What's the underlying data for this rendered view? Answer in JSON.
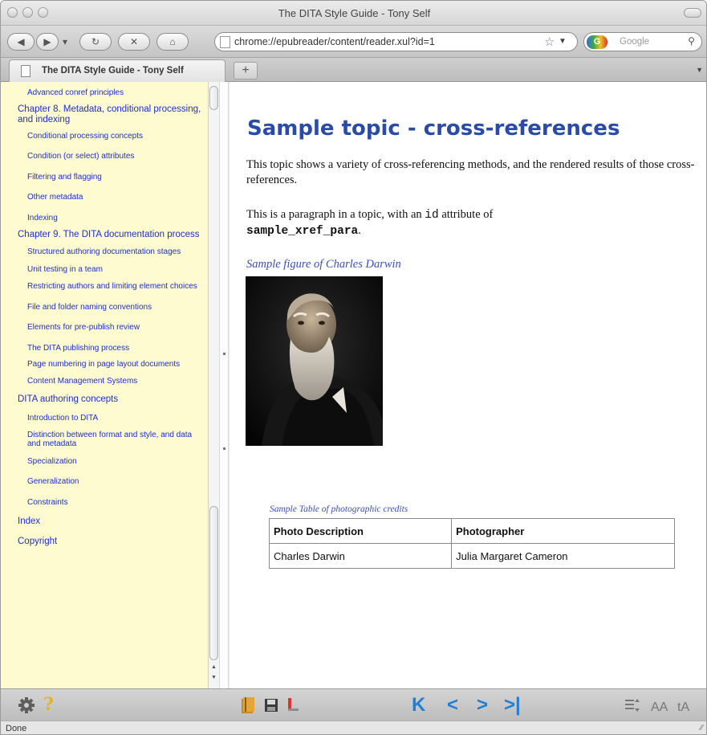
{
  "window": {
    "title": "The DITA Style Guide - Tony Self"
  },
  "navbar": {
    "url": "chrome://epubreader/content/reader.xul?id=1",
    "search_placeholder": "Google",
    "search_engine_badge": "G"
  },
  "tabs": [
    {
      "label": "The DITA Style Guide - Tony Self"
    }
  ],
  "toc": [
    {
      "label": "Advanced conref principles",
      "level": 2
    },
    {
      "label": "Chapter 8. Metadata, conditional processing, and indexing",
      "level": 1
    },
    {
      "label": "Conditional processing concepts",
      "level": 2
    },
    {
      "label": "Condition (or select) attributes",
      "level": 2
    },
    {
      "label": "Filtering and flagging",
      "level": 2
    },
    {
      "label": "Other metadata",
      "level": 2
    },
    {
      "label": "Indexing",
      "level": 2
    },
    {
      "label": "Chapter 9. The DITA documentation process",
      "level": 1
    },
    {
      "label": "Structured authoring documentation stages",
      "level": 2
    },
    {
      "label": "Unit testing in a team",
      "level": 2
    },
    {
      "label": "Restricting authors and limiting element choices",
      "level": 2
    },
    {
      "label": "File and folder naming conventions",
      "level": 2
    },
    {
      "label": "Elements for pre-publish review",
      "level": 2
    },
    {
      "label": "The DITA publishing process",
      "level": 2
    },
    {
      "label": "Page numbering in page layout documents",
      "level": 2
    },
    {
      "label": "Content Management Systems",
      "level": 2
    },
    {
      "label": "DITA authoring concepts",
      "level": 1
    },
    {
      "label": "Introduction to DITA",
      "level": 2
    },
    {
      "label": "Distinction between format and style, and data and metadata",
      "level": 2
    },
    {
      "label": "Specialization",
      "level": 2
    },
    {
      "label": "Generalization",
      "level": 2
    },
    {
      "label": "Constraints",
      "level": 2
    },
    {
      "label": "Index",
      "level": 1
    },
    {
      "label": "Copyright",
      "level": 1
    }
  ],
  "content": {
    "heading": "Sample topic - cross-references",
    "para1": "This topic shows a variety of cross-referencing methods, and the rendered results of those cross-references.",
    "para2_start": "This is a paragraph in a topic, with an ",
    "para2_code": "id",
    "para2_mid": " attribute of",
    "para2_id_value": "sample_xref_para",
    "para2_end": ".",
    "figure_caption": "Sample figure of Charles Darwin",
    "table_caption": "Sample Table of photographic credits",
    "table": {
      "headers": [
        "Photo Description",
        "Photographer"
      ],
      "rows": [
        [
          "Charles Darwin",
          "Julia Margaret Cameron"
        ]
      ]
    }
  },
  "status": {
    "text": "Done"
  },
  "colors": {
    "toc_link": "#1c2ed8",
    "heading": "#2a4ba8",
    "nav_arrow": "#1f7fd6",
    "sidebar_bg": "#fffbd0"
  },
  "icons": {
    "back": "back-arrow-icon",
    "forward": "forward-arrow-icon",
    "reload": "reload-icon",
    "stop": "stop-icon",
    "home": "home-icon",
    "bookmark_star": "star-icon",
    "settings": "gear-icon",
    "help": "question-icon",
    "first_page": "first-page-icon",
    "prev_page": "prev-page-icon",
    "next_page": "next-page-icon",
    "last_page": "last-page-icon"
  },
  "bottombar": {
    "help_glyph": "?",
    "first_glyph": "K",
    "prev_glyph": "<",
    "next_glyph": ">",
    "last_glyph": ">|",
    "font_decrease": "AA",
    "font_increase": "tA"
  }
}
